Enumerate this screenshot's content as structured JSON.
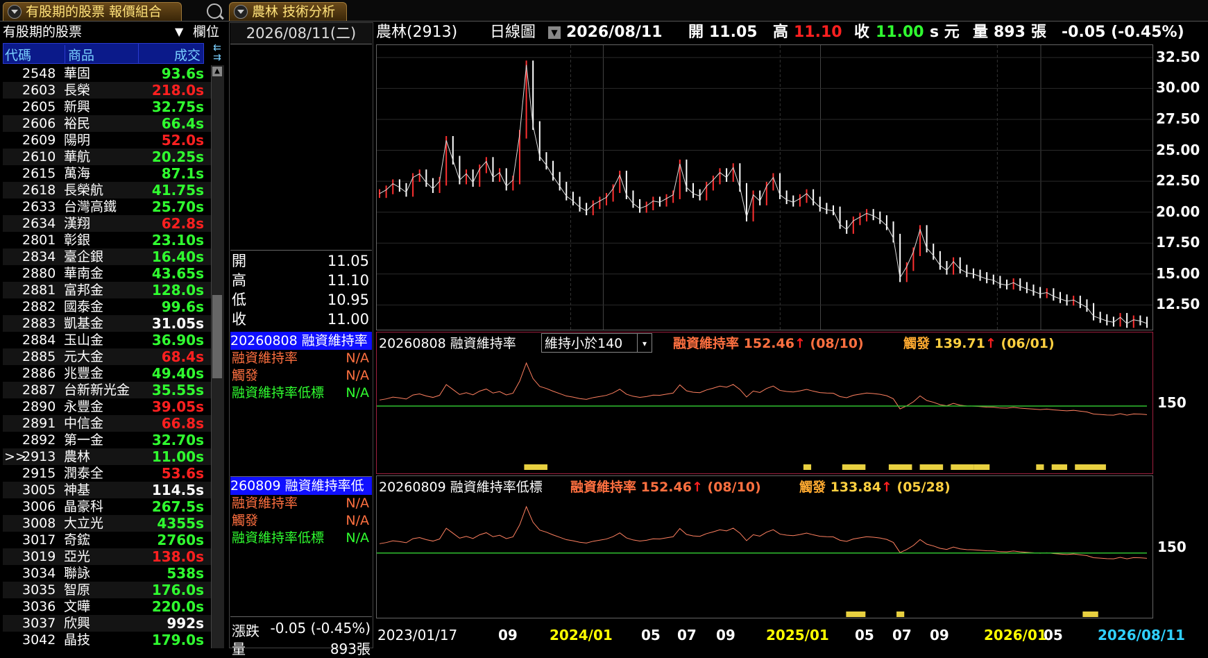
{
  "tabs": [
    {
      "label": "有股期的股票 報價組合"
    },
    {
      "label": "農林 技術分析"
    }
  ],
  "left_panel": {
    "title": "有股期的股票",
    "settings_label": "欄位",
    "columns": {
      "code": "代碼",
      "name": "商品",
      "price": "成交"
    },
    "rows": [
      {
        "code": "2548",
        "name": "華固",
        "price": "93.6s",
        "color": "#30ff30"
      },
      {
        "code": "2603",
        "name": "長榮",
        "price": "218.0s",
        "color": "#ff2020"
      },
      {
        "code": "2605",
        "name": "新興",
        "price": "32.75s",
        "color": "#30ff30"
      },
      {
        "code": "2606",
        "name": "裕民",
        "price": "66.4s",
        "color": "#30ff30"
      },
      {
        "code": "2609",
        "name": "陽明",
        "price": "52.0s",
        "color": "#ff2020"
      },
      {
        "code": "2610",
        "name": "華航",
        "price": "20.25s",
        "color": "#30ff30"
      },
      {
        "code": "2615",
        "name": "萬海",
        "price": "87.1s",
        "color": "#30ff30"
      },
      {
        "code": "2618",
        "name": "長榮航",
        "price": "41.75s",
        "color": "#30ff30"
      },
      {
        "code": "2633",
        "name": "台灣高鐵",
        "price": "25.70s",
        "color": "#30ff30"
      },
      {
        "code": "2634",
        "name": "漢翔",
        "price": "62.8s",
        "color": "#ff2020"
      },
      {
        "code": "2801",
        "name": "彰銀",
        "price": "23.10s",
        "color": "#30ff30"
      },
      {
        "code": "2834",
        "name": "臺企銀",
        "price": "16.40s",
        "color": "#30ff30"
      },
      {
        "code": "2880",
        "name": "華南金",
        "price": "43.65s",
        "color": "#30ff30"
      },
      {
        "code": "2881",
        "name": "富邦金",
        "price": "128.0s",
        "color": "#30ff30"
      },
      {
        "code": "2882",
        "name": "國泰金",
        "price": "99.6s",
        "color": "#30ff30"
      },
      {
        "code": "2883",
        "name": "凱基金",
        "price": "31.05s",
        "color": "#ffffff"
      },
      {
        "code": "2884",
        "name": "玉山金",
        "price": "36.90s",
        "color": "#30ff30"
      },
      {
        "code": "2885",
        "name": "元大金",
        "price": "68.4s",
        "color": "#ff2020"
      },
      {
        "code": "2886",
        "name": "兆豐金",
        "price": "49.40s",
        "color": "#30ff30"
      },
      {
        "code": "2887",
        "name": "台新新光金",
        "price": "35.55s",
        "color": "#30ff30"
      },
      {
        "code": "2890",
        "name": "永豐金",
        "price": "39.05s",
        "color": "#ff2020"
      },
      {
        "code": "2891",
        "name": "中信金",
        "price": "66.8s",
        "color": "#ff2020"
      },
      {
        "code": "2892",
        "name": "第一金",
        "price": "32.70s",
        "color": "#30ff30"
      },
      {
        "code": "2913",
        "name": "農林",
        "price": "11.00s",
        "color": "#30ff30",
        "selected": ">>"
      },
      {
        "code": "2915",
        "name": "潤泰全",
        "price": "53.6s",
        "color": "#ff2020"
      },
      {
        "code": "3005",
        "name": "神基",
        "price": "114.5s",
        "color": "#ffffff"
      },
      {
        "code": "3006",
        "name": "晶豪科",
        "price": "267.5s",
        "color": "#30ff30"
      },
      {
        "code": "3008",
        "name": "大立光",
        "price": "4355s",
        "color": "#30ff30"
      },
      {
        "code": "3017",
        "name": "奇鋐",
        "price": "2760s",
        "color": "#30ff30"
      },
      {
        "code": "3019",
        "name": "亞光",
        "price": "138.0s",
        "color": "#ff2020"
      },
      {
        "code": "3034",
        "name": "聯詠",
        "price": "538s",
        "color": "#30ff30"
      },
      {
        "code": "3035",
        "name": "智原",
        "price": "176.0s",
        "color": "#30ff30"
      },
      {
        "code": "3036",
        "name": "文曄",
        "price": "220.0s",
        "color": "#30ff30"
      },
      {
        "code": "3037",
        "name": "欣興",
        "price": "992s",
        "color": "#ffffff"
      },
      {
        "code": "3042",
        "name": "晶技",
        "price": "179.0s",
        "color": "#30ff30"
      }
    ]
  },
  "middle": {
    "date": "2026/08/11(二)",
    "ohlc": [
      {
        "label": "開",
        "value": "11.05"
      },
      {
        "label": "高",
        "value": "11.10"
      },
      {
        "label": "低",
        "value": "10.95"
      },
      {
        "label": "收",
        "value": "11.00"
      }
    ],
    "ind1": {
      "title": "20260808 融資維持率",
      "rows": [
        {
          "label": "融資維持率",
          "value": "N/A",
          "color": "#ff7040"
        },
        {
          "label": "觸發",
          "value": "N/A",
          "color": "#ff7040"
        },
        {
          "label": "融資維持率低標",
          "value": "N/A",
          "color": "#30ff30"
        }
      ]
    },
    "ind2": {
      "title": "260809 融資維持率低",
      "rows": [
        {
          "label": "融資維持率",
          "value": "N/A",
          "color": "#ff7040"
        },
        {
          "label": "觸發",
          "value": "N/A",
          "color": "#ff7040"
        },
        {
          "label": "融資維持率低標",
          "value": "N/A",
          "color": "#30ff30"
        }
      ]
    },
    "change_label": "漲跌",
    "change_value": "-0.05 (-0.45%)",
    "vol_label": "量",
    "vol_value": "893張"
  },
  "header": {
    "name": "農林(2913)",
    "period": "日線圖",
    "date": "2026/08/11",
    "open_label": "開",
    "open": "11.05",
    "high_label": "高",
    "high": "11.10",
    "close_label": "收",
    "close": "11.00",
    "unit": "s 元",
    "vol_label": "量",
    "vol": "893",
    "vol_unit": "張",
    "change": "-0.05 (-0.45%)"
  },
  "ind1_hdr": {
    "title": "20260808 融資維持率",
    "select": "維持小於140",
    "m_label": "融資維持率",
    "m_val": "152.46",
    "m_date": "(08/10)",
    "t_label": "觸發",
    "t_val": "139.71",
    "t_date": "(06/01)"
  },
  "ind2_hdr": {
    "title": "20260809 融資維持率低標",
    "m_label": "融資維持率",
    "m_val": "152.46",
    "m_date": "(08/10)",
    "t_label": "觸發",
    "t_val": "133.84",
    "t_date": "(05/28)"
  },
  "x_axis": [
    {
      "label": "2023/01/17",
      "color": "#ffffff"
    },
    {
      "label": "09",
      "color": "#ffffff"
    },
    {
      "label": "2024/01",
      "color": "#ffff00"
    },
    {
      "label": "05",
      "color": "#ffffff"
    },
    {
      "label": "07",
      "color": "#ffffff"
    },
    {
      "label": "09",
      "color": "#ffffff"
    },
    {
      "label": "2025/01",
      "color": "#ffff00"
    },
    {
      "label": "05",
      "color": "#ffffff"
    },
    {
      "label": "07",
      "color": "#ffffff"
    },
    {
      "label": "09",
      "color": "#ffffff"
    },
    {
      "label": "2026/01",
      "color": "#ffff00"
    },
    {
      "label": "05",
      "color": "#ffffff"
    },
    {
      "label": "2026/08/11",
      "color": "#30d0ff"
    }
  ],
  "chart_data": {
    "type": "line",
    "price_ticks": [
      "32.50",
      "30.00",
      "27.50",
      "25.00",
      "22.50",
      "20.00",
      "17.50",
      "15.00",
      "12.50"
    ],
    "ylim": [
      10.5,
      33.5
    ],
    "price_series": [
      21.5,
      21.8,
      22.3,
      22.0,
      21.6,
      22.8,
      23.1,
      22.4,
      21.9,
      22.5,
      25.8,
      24.2,
      22.6,
      23.1,
      22.4,
      23.5,
      24.1,
      22.8,
      23.2,
      22.1,
      22.6,
      26.3,
      31.9,
      27.0,
      24.5,
      23.8,
      22.9,
      22.1,
      21.3,
      20.9,
      20.4,
      20.1,
      20.6,
      20.9,
      21.2,
      21.9,
      23.0,
      21.4,
      20.7,
      20.3,
      20.5,
      20.9,
      20.8,
      21.1,
      21.4,
      23.9,
      22.0,
      21.5,
      21.3,
      22.1,
      22.6,
      23.2,
      22.8,
      23.6,
      22.0,
      19.6,
      21.4,
      20.9,
      22.1,
      22.8,
      21.4,
      21.0,
      20.8,
      21.1,
      21.5,
      20.9,
      20.4,
      20.2,
      20.1,
      19.0,
      18.6,
      19.3,
      19.6,
      19.9,
      19.7,
      19.4,
      18.9,
      17.9,
      14.7,
      15.6,
      16.8,
      18.6,
      17.1,
      16.5,
      15.7,
      15.3,
      16.0,
      15.4,
      15.1,
      15.0,
      14.8,
      14.6,
      14.5,
      14.2,
      14.1,
      14.3,
      14.0,
      13.8,
      13.6,
      13.4,
      13.5,
      13.2,
      13.0,
      12.8,
      12.9,
      12.6,
      12.3,
      11.6,
      11.4,
      11.2,
      11.1,
      11.5,
      11.0,
      11.3,
      11.2,
      11.0
    ],
    "ind_ticks": [
      "150",
      "150"
    ],
    "ind_level": 150,
    "ind1_threshold": 140,
    "ind2_threshold": 133.84,
    "ind1_trigger_segments": [
      [
        0.19,
        0.22
      ],
      [
        0.55,
        0.56
      ],
      [
        0.6,
        0.63
      ],
      [
        0.66,
        0.69
      ],
      [
        0.7,
        0.73
      ],
      [
        0.74,
        0.77
      ],
      [
        0.77,
        0.79
      ],
      [
        0.85,
        0.86
      ],
      [
        0.87,
        0.89
      ],
      [
        0.9,
        0.94
      ]
    ],
    "ind2_trigger_segments": [
      [
        0.605,
        0.63
      ],
      [
        0.67,
        0.68
      ],
      [
        0.91,
        0.93
      ]
    ]
  }
}
